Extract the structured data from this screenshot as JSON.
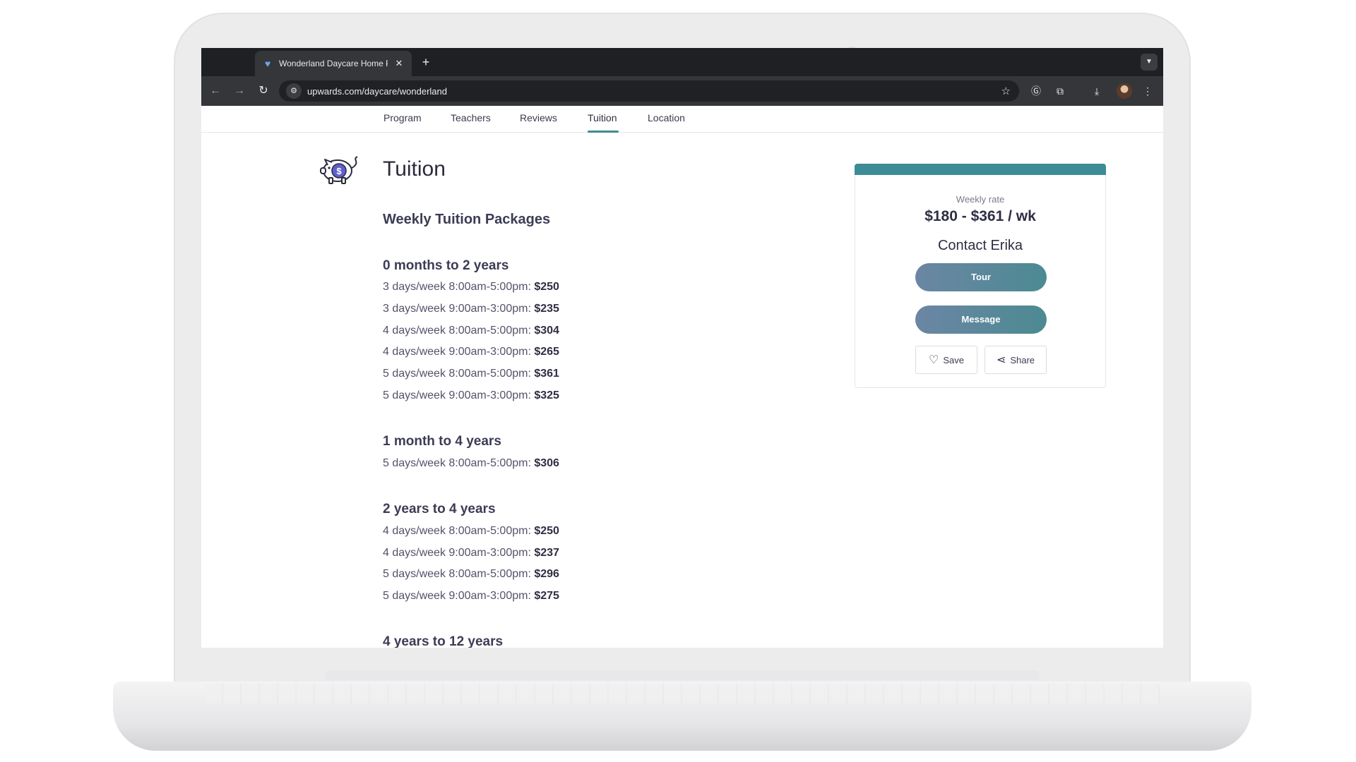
{
  "browser": {
    "tab_title": "Wonderland Daycare Home P",
    "url": "upwards.com/daycare/wonderland"
  },
  "nav": {
    "items": [
      "Program",
      "Teachers",
      "Reviews",
      "Tuition",
      "Location"
    ],
    "active": "Tuition"
  },
  "page": {
    "section_title": "Tuition",
    "packages_title": "Weekly Tuition Packages",
    "groups": [
      {
        "title": "0 months to 2 years",
        "lines": [
          {
            "label": "3 days/week 8:00am-5:00pm:",
            "price": "$250"
          },
          {
            "label": "3 days/week 9:00am-3:00pm:",
            "price": "$235"
          },
          {
            "label": "4 days/week 8:00am-5:00pm:",
            "price": "$304"
          },
          {
            "label": "4 days/week 9:00am-3:00pm:",
            "price": "$265"
          },
          {
            "label": "5 days/week 8:00am-5:00pm:",
            "price": "$361"
          },
          {
            "label": "5 days/week 9:00am-3:00pm:",
            "price": "$325"
          }
        ]
      },
      {
        "title": "1 month to 4 years",
        "lines": [
          {
            "label": "5 days/week 8:00am-5:00pm:",
            "price": "$306"
          }
        ]
      },
      {
        "title": "2 years to 4 years",
        "lines": [
          {
            "label": "4 days/week 8:00am-5:00pm:",
            "price": "$250"
          },
          {
            "label": "4 days/week 9:00am-3:00pm:",
            "price": "$237"
          },
          {
            "label": "5 days/week 8:00am-5:00pm:",
            "price": "$296"
          },
          {
            "label": "5 days/week 9:00am-3:00pm:",
            "price": "$275"
          }
        ]
      },
      {
        "title": "4 years to 12 years",
        "lines": []
      }
    ]
  },
  "card": {
    "rate_label": "Weekly rate",
    "rate_value": "$180 - $361 / wk",
    "contact": "Contact Erika",
    "tour_label": "Tour",
    "message_label": "Message",
    "save_label": "Save",
    "share_label": "Share"
  },
  "colors": {
    "accent": "#3d8c95",
    "button_gradient_start": "#6b86a4",
    "button_gradient_end": "#4c8a92"
  }
}
